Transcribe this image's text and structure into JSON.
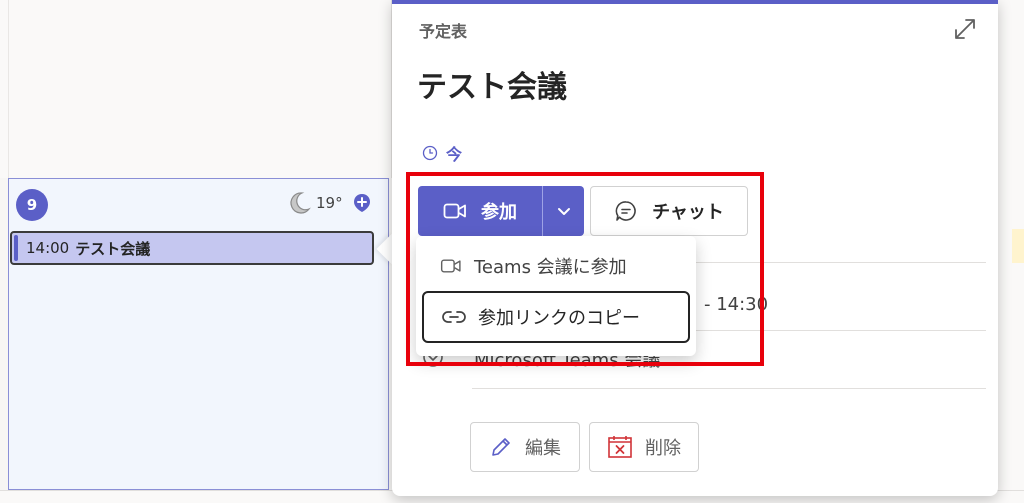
{
  "calendar": {
    "day_number": "9",
    "weather_temp": "19°",
    "event": {
      "time": "14:00",
      "title": "テスト会議"
    }
  },
  "popover": {
    "section_label": "予定表",
    "title": "テスト会議",
    "time_label": "今",
    "join_label": "参加",
    "chat_label": "チャット",
    "detail_time": "- 14:30",
    "detail_location": "Microsoft Teams 会議",
    "edit_label": "編集",
    "delete_label": "削除"
  },
  "join_menu": {
    "items": [
      {
        "label": "Teams 会議に参加"
      },
      {
        "label": "参加リンクのコピー"
      }
    ]
  },
  "colors": {
    "accent": "#5b5fc7",
    "highlight": "#e8000b",
    "event_fill": "#c5c7f0"
  }
}
